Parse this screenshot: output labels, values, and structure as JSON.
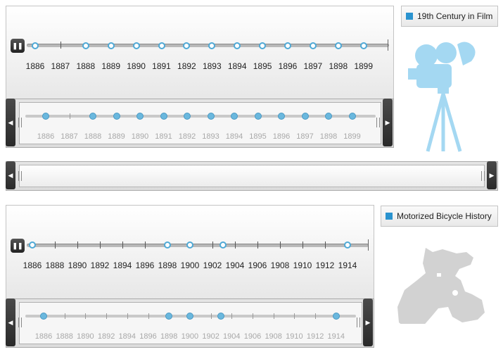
{
  "timeline1": {
    "legend": "19th Century in Film",
    "years": [
      "1886",
      "1887",
      "1888",
      "1889",
      "1890",
      "1891",
      "1892",
      "1893",
      "1894",
      "1895",
      "1896",
      "1897",
      "1898",
      "1899"
    ],
    "nav_years": [
      "1886",
      "1887",
      "1888",
      "1889",
      "1890",
      "1891",
      "1892",
      "1893",
      "1894",
      "1895",
      "1896",
      "1897",
      "1898",
      "1899"
    ],
    "play_icon": "pause-icon",
    "image_icon": "movie-camera-icon"
  },
  "timeline2": {
    "legend": "Motorized Bicycle History",
    "years": [
      "1886",
      "1888",
      "1890",
      "1892",
      "1894",
      "1896",
      "1898",
      "1900",
      "1902",
      "1904",
      "1906",
      "1908",
      "1910",
      "1912",
      "1914"
    ],
    "nav_years": [
      "1886",
      "1888",
      "1890",
      "1892",
      "1894",
      "1896",
      "1898",
      "1900",
      "1902",
      "1904",
      "1906",
      "1908",
      "1910",
      "1912",
      "1914"
    ],
    "play_icon": "pause-icon",
    "image_icon": "motorcycle-icon"
  },
  "colors": {
    "accent": "#4fa9d6",
    "legend_swatch": "#2a93cf",
    "camera": "#a4d8f2",
    "bike": "#d2d2d2"
  }
}
